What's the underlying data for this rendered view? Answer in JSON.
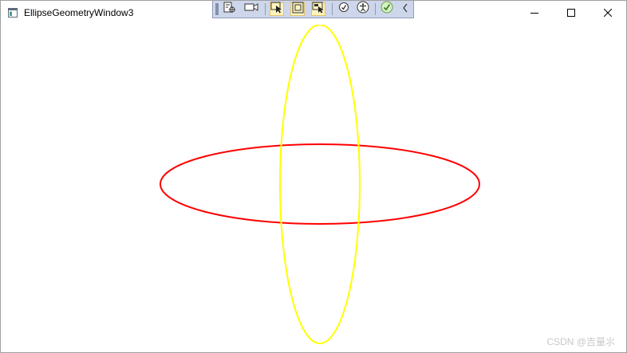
{
  "window": {
    "title": "EllipseGeometryWindow3",
    "icon": "app-window-icon",
    "controls": {
      "minimize": "minimize-icon",
      "maximize": "maximize-icon",
      "close": "close-icon"
    }
  },
  "debug_toolbar": {
    "buttons": [
      {
        "name": "go-to-live-visual-tree-icon"
      },
      {
        "name": "video-camera-icon"
      },
      {
        "name": "select-element-icon"
      },
      {
        "name": "display-layout-adorners-icon"
      },
      {
        "name": "track-focused-element-icon"
      },
      {
        "name": "binding-failures-icon"
      },
      {
        "name": "accessibility-icon"
      },
      {
        "name": "checkmark-icon"
      },
      {
        "name": "collapse-chevron-icon"
      }
    ]
  },
  "canvas": {
    "shapes": [
      {
        "name": "horizontal-ellipse",
        "stroke": "#ff0000"
      },
      {
        "name": "vertical-ellipse",
        "stroke": "#ffff00"
      }
    ]
  },
  "watermark": {
    "text": "CSDN @吉量⺢"
  }
}
